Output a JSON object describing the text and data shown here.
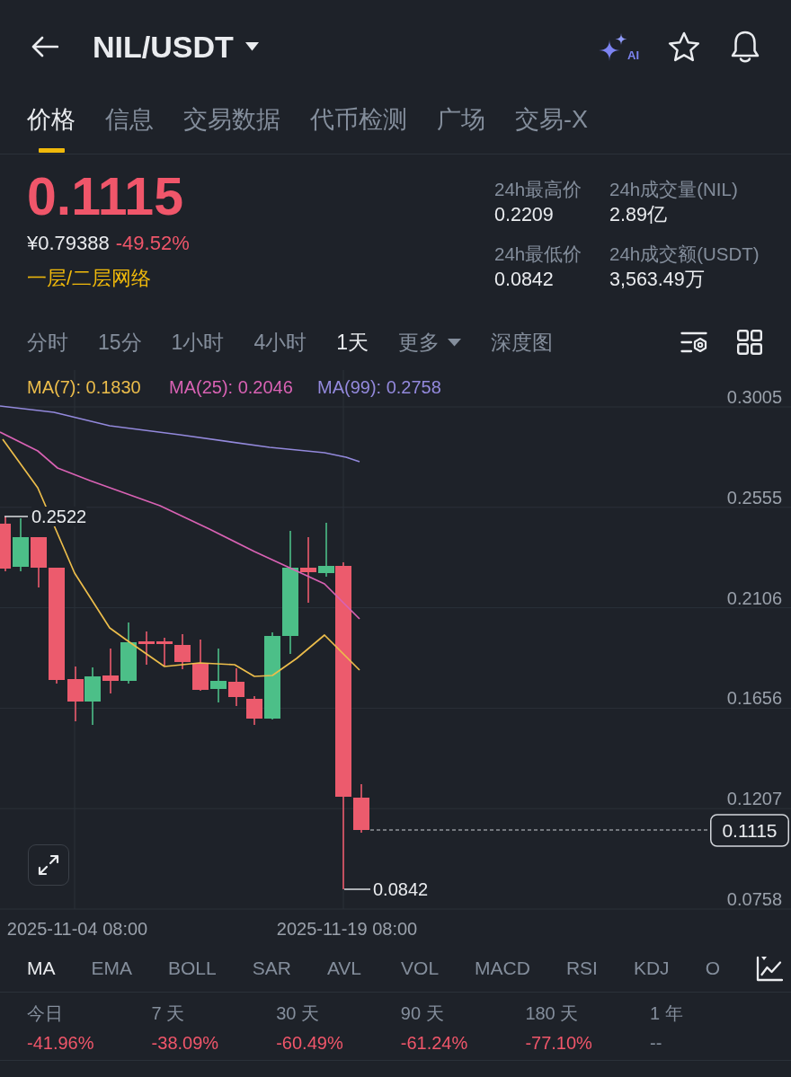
{
  "header": {
    "title": "NIL/USDT",
    "ai_label": "AI"
  },
  "tabs": [
    {
      "label": "价格",
      "selected": true
    },
    {
      "label": "信息",
      "selected": false
    },
    {
      "label": "交易数据",
      "selected": false
    },
    {
      "label": "代币检测",
      "selected": false
    },
    {
      "label": "广场",
      "selected": false
    },
    {
      "label": "交易-X",
      "selected": false
    }
  ],
  "price": {
    "last": "0.1115",
    "cny": "¥0.79388",
    "change": "-49.52%",
    "tag": "一层/二层网络"
  },
  "stats": [
    {
      "label": "24h最高价",
      "value": "0.2209"
    },
    {
      "label": "24h成交量(NIL)",
      "value": "2.89亿"
    },
    {
      "label": "24h最低价",
      "value": "0.0842"
    },
    {
      "label": "24h成交额(USDT)",
      "value": "3,563.49万"
    }
  ],
  "intervals": [
    {
      "label": "分时",
      "selected": false,
      "kind": "option"
    },
    {
      "label": "15分",
      "selected": false,
      "kind": "option"
    },
    {
      "label": "1小时",
      "selected": false,
      "kind": "option"
    },
    {
      "label": "4小时",
      "selected": false,
      "kind": "option"
    },
    {
      "label": "1天",
      "selected": true,
      "kind": "option"
    },
    {
      "label": "更多",
      "selected": false,
      "kind": "dropdown"
    },
    {
      "label": "深度图",
      "selected": false,
      "kind": "option"
    }
  ],
  "chart": {
    "legend": [
      {
        "label": "MA(7): 0.1830",
        "color": "#ecbd4b"
      },
      {
        "label": "MA(25): 0.2046",
        "color": "#d962b4"
      },
      {
        "label": "MA(99): 0.2758",
        "color": "#9389dc"
      }
    ],
    "y_labels": [
      "0.3005",
      "0.2555",
      "0.2106",
      "0.1656",
      "0.1207",
      "0.0758"
    ],
    "x_labels": [
      "2025-11-04 08:00",
      "2025-11-19 08:00"
    ],
    "high_label": "0.2522",
    "low_label": "0.0842",
    "last_price": "0.1115"
  },
  "indicators": {
    "main": [
      {
        "label": "MA",
        "selected": true
      },
      {
        "label": "EMA",
        "selected": false
      },
      {
        "label": "BOLL",
        "selected": false
      },
      {
        "label": "SAR",
        "selected": false
      },
      {
        "label": "AVL",
        "selected": false
      }
    ],
    "sub": [
      {
        "label": "VOL",
        "selected": false
      },
      {
        "label": "MACD",
        "selected": false
      },
      {
        "label": "RSI",
        "selected": false
      },
      {
        "label": "KDJ",
        "selected": false
      },
      {
        "label": "O",
        "selected": false
      }
    ]
  },
  "performance": [
    {
      "period": "今日",
      "change": "-41.96%",
      "negative": true
    },
    {
      "period": "7 天",
      "change": "-38.09%",
      "negative": true
    },
    {
      "period": "30 天",
      "change": "-60.49%",
      "negative": true
    },
    {
      "period": "90 天",
      "change": "-61.24%",
      "negative": true
    },
    {
      "period": "180 天",
      "change": "-77.10%",
      "negative": true
    },
    {
      "period": "1 年",
      "change": "--",
      "negative": false
    }
  ]
}
